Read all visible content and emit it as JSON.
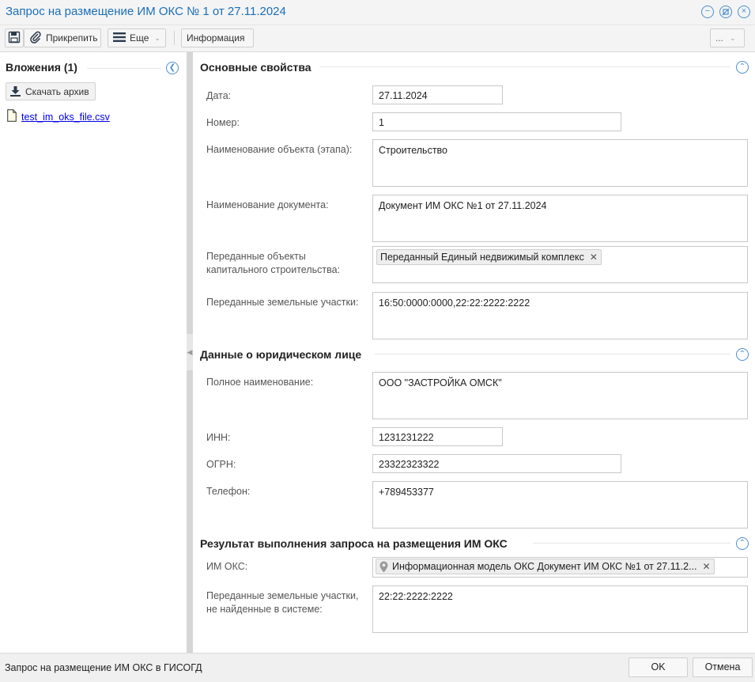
{
  "window": {
    "title": "Запрос на размещение ИМ ОКС № 1 от 27.11.2024"
  },
  "toolbar": {
    "attach_label": "Прикрепить",
    "more_label": "Еще",
    "info_label": "Информация",
    "overflow_label": "..."
  },
  "attachments": {
    "title": "Вложения (1)",
    "download_label": "Скачать архив",
    "file_name": "test_im_oks_file.csv"
  },
  "section1": {
    "title": "Основные свойства",
    "date_label": "Дата:",
    "date_value": "27.11.2024",
    "number_label": "Номер:",
    "number_value": "1",
    "object_name_label": "Наименование объекта (этапа):",
    "object_name_value": "Строительство",
    "doc_name_label": "Наименование документа:",
    "doc_name_value": "Документ ИМ ОКС №1 от 27.11.2024",
    "cap_objects_label_1": "Переданные объекты",
    "cap_objects_label_2": "капитального строительства:",
    "cap_objects_tag": "Переданный Единый недвижимый комплекс",
    "land_plots_label": "Переданные земельные участки:",
    "land_plots_value": "16:50:0000:0000,22:22:2222:2222"
  },
  "section2": {
    "title": "Данные о юридическом лице",
    "full_name_label": "Полное наименование:",
    "full_name_value": "ООО \"ЗАСТРОЙКА ОМСК\"",
    "inn_label": "ИНН:",
    "inn_value": "1231231222",
    "ogrn_label": "ОГРН:",
    "ogrn_value": "23322323322",
    "phone_label": "Телефон:",
    "phone_value": "+789453377"
  },
  "section3": {
    "title": "Результат выполнения запроса на размещения ИМ ОКС",
    "im_oks_label": "ИМ ОКС:",
    "im_oks_tag": "Информационная модель ОКС Документ ИМ ОКС №1 от 27.11.2...",
    "not_found_label_1": "Переданные земельные участки,",
    "not_found_label_2": "не найденные в системе:",
    "not_found_value": "22:22:2222:2222"
  },
  "footer": {
    "status": "Запрос на размещение ИМ ОКС в ГИСОГД",
    "ok_label": "OK",
    "cancel_label": "Отмена"
  },
  "colors": {
    "title_blue": "#1b6fb8",
    "accent": "#4d8ed1",
    "link": "#0000ee"
  }
}
